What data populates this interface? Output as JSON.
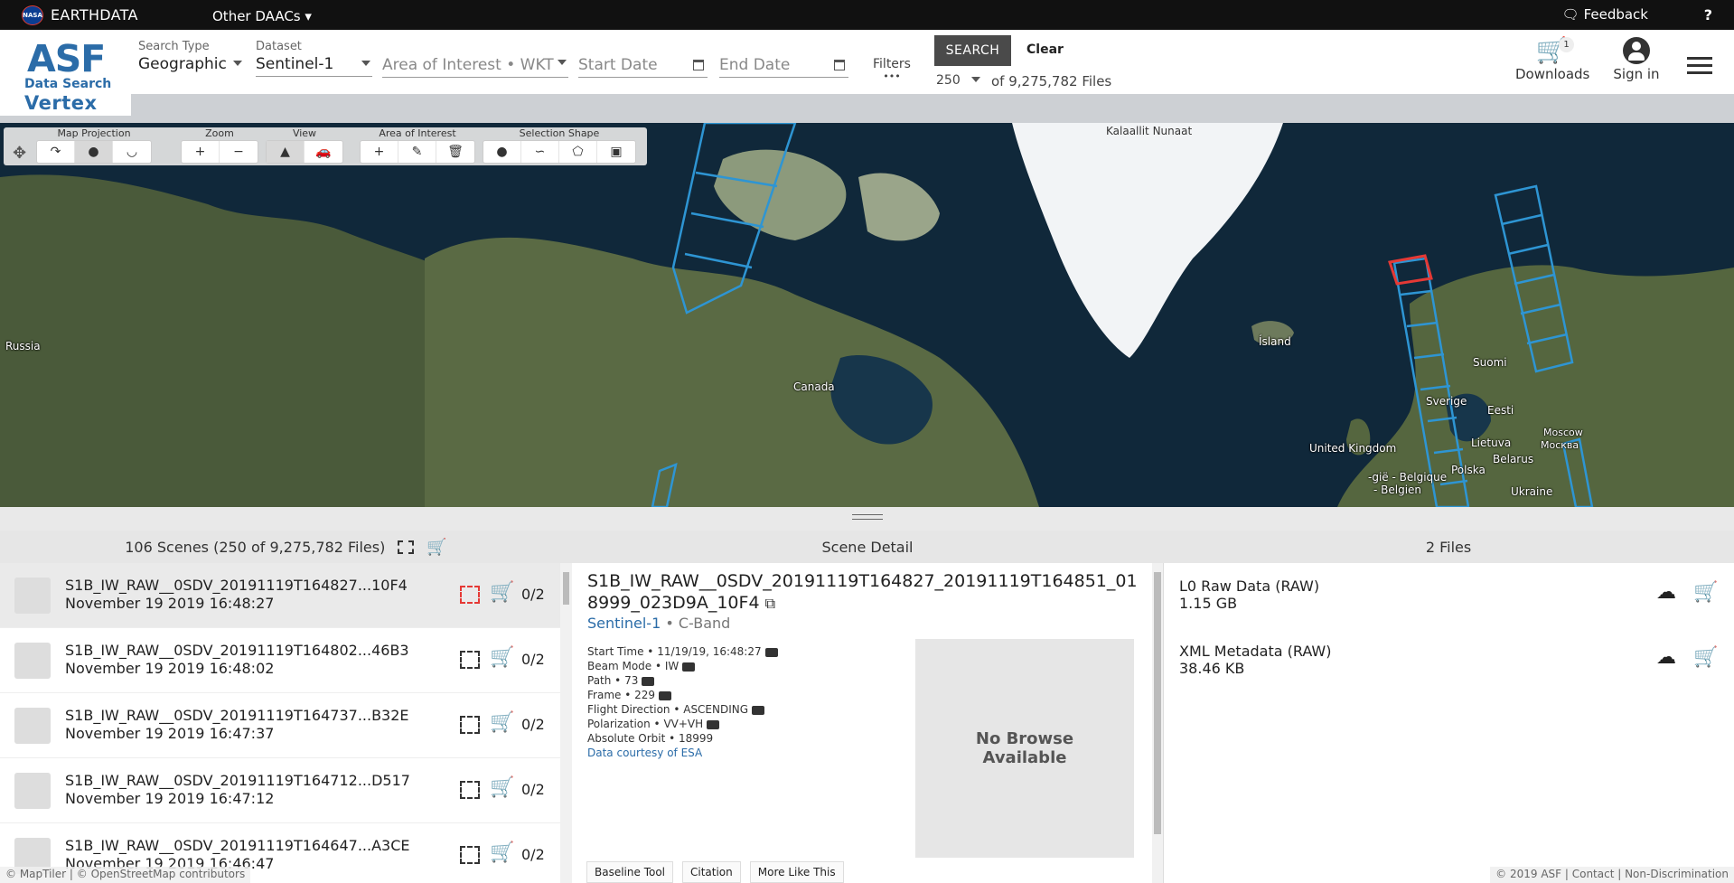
{
  "topbar": {
    "nasa_logo": "NASA",
    "brand": "EARTHDATA",
    "daacs_label": "Other DAACs ▾",
    "feedback_label": "Feedback",
    "help_label": "?"
  },
  "logo": {
    "asf": "ASF",
    "data_search": "Data Search",
    "vertex": "Vertex"
  },
  "search": {
    "type_label": "Search Type",
    "type_value": "Geographic",
    "dataset_label": "Dataset",
    "dataset_value": "Sentinel-1",
    "aoi_placeholder": "Area of Interest • WKT",
    "start_placeholder": "Start Date",
    "end_placeholder": "End Date",
    "filters_label": "Filters",
    "filters_dots": "•••",
    "search_button": "SEARCH",
    "clear_button": "Clear",
    "max_results": "250",
    "of_count": "of 9,275,782 Files"
  },
  "nav": {
    "downloads_label": "Downloads",
    "downloads_count": "1",
    "signin_label": "Sign in"
  },
  "map_toolbar": {
    "groups": [
      "Map Projection",
      "Zoom",
      "View",
      "Area of Interest",
      "Selection Shape"
    ],
    "zoom_in": "+",
    "zoom_out": "−",
    "aoi_add": "+"
  },
  "map_labels": {
    "russia": "Russia",
    "canada": "Canada",
    "greenland": "Kalaallit Nunaat",
    "iceland": "Ísland",
    "uk": "United Kingdom",
    "suomi": "Suomi",
    "sverige": "Sverige",
    "eesti": "Eesti",
    "lietuva": "Lietuva",
    "belarus": "Belarus",
    "polska": "Polska",
    "ukraine": "Ukraine",
    "moscow": "Moscow",
    "moskva": "Москва",
    "belgie": "-gië - Belgique",
    "belgien": "- Belgien"
  },
  "results": {
    "header": "106 Scenes (250 of 9,275,782 Files)",
    "scenes": [
      {
        "name": "S1B_IW_RAW__0SDV_20191119T164827...10F4",
        "date": "November 19 2019 16:48:27",
        "files": "0/2"
      },
      {
        "name": "S1B_IW_RAW__0SDV_20191119T164802...46B3",
        "date": "November 19 2019 16:48:02",
        "files": "0/2"
      },
      {
        "name": "S1B_IW_RAW__0SDV_20191119T164737...B32E",
        "date": "November 19 2019 16:47:37",
        "files": "0/2"
      },
      {
        "name": "S1B_IW_RAW__0SDV_20191119T164712...D517",
        "date": "November 19 2019 16:47:12",
        "files": "0/2"
      },
      {
        "name": "S1B_IW_RAW__0SDV_20191119T164647...A3CE",
        "date": "November 19 2019 16:46:47",
        "files": "0/2"
      }
    ]
  },
  "detail": {
    "header": "Scene Detail",
    "title": "S1B_IW_RAW__0SDV_20191119T164827_20191119T164851_018999_023D9A_10F4",
    "platform": "Sentinel-1",
    "band": "• C-Band",
    "props": [
      "Start Time • 11/19/19, 16:48:27",
      "Beam Mode • IW",
      "Path • 73",
      "Frame • 229",
      "Flight Direction • ASCENDING",
      "Polarization • VV+VH",
      "Absolute Orbit • 18999"
    ],
    "courtesy": "Data courtesy of ESA",
    "no_browse": "No Browse Available",
    "buttons": [
      "Baseline Tool",
      "Citation",
      "More Like This"
    ]
  },
  "files": {
    "header": "2 Files",
    "items": [
      {
        "name": "L0 Raw Data (RAW)",
        "size": "1.15 GB"
      },
      {
        "name": "XML Metadata (RAW)",
        "size": "38.46 KB"
      }
    ]
  },
  "footer": {
    "attribution": "© MapTiler | © OpenStreetMap contributors",
    "copyright": "© 2019 ASF  | Contact | Non-Discrimination"
  },
  "colors": {
    "accent": "#2b6ca8",
    "footprint": "#2e95d3",
    "selected_footprint": "#e53935"
  }
}
